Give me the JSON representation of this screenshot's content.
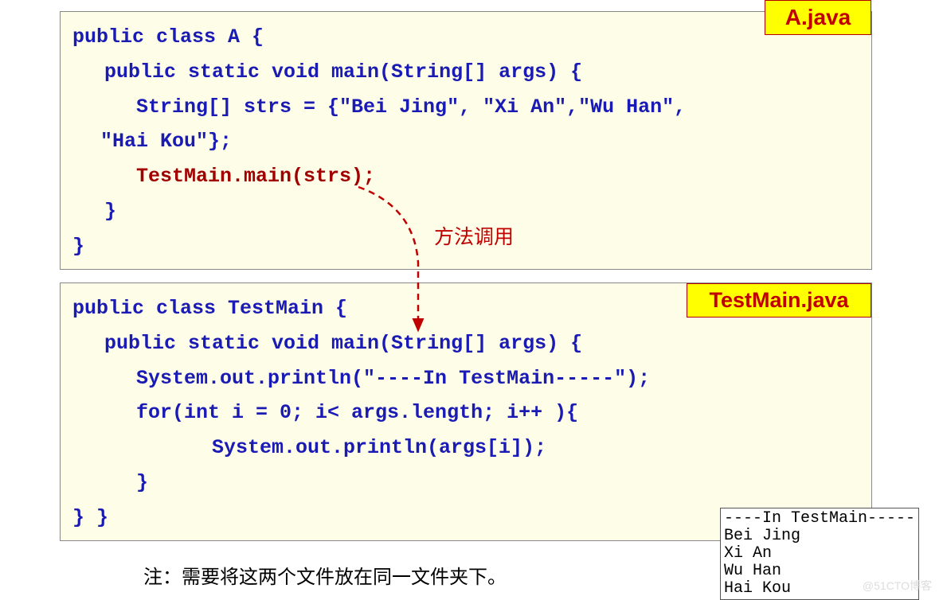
{
  "file1_label": "A.java",
  "file2_label": "TestMain.java",
  "annotation": "方法调用",
  "note": "注：需要将这两个文件放在同一文件夹下。",
  "watermark": "@51CTO博客",
  "code1": {
    "l1": "public class A {",
    "l2": "public static void main(String[] args) {",
    "l3a": "String[] strs = {\"Bei Jing\", \"Xi An\",\"Wu Han\",",
    "l3b": "\"Hai Kou\"};",
    "l4": "TestMain.main(strs);",
    "l5": "}",
    "l6": "}"
  },
  "code2": {
    "l1": "public class TestMain {",
    "l2": "public static void main(String[] args) {",
    "l3": "System.out.println(\"----In TestMain-----\");",
    "l4": "for(int i = 0; i< args.length; i++ ){",
    "l5": "System.out.println(args[i]);",
    "l6": "}",
    "l7": "}  }"
  },
  "output": "----In TestMain-----\nBei Jing\nXi An\nWu Han\nHai Kou "
}
